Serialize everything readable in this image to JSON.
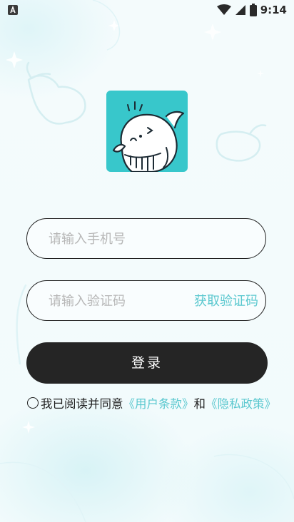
{
  "status_bar": {
    "time": "9:14"
  },
  "login": {
    "phone_placeholder": "请输入手机号",
    "code_placeholder": "请输入验证码",
    "get_code_label": "获取验证码",
    "login_label": "登录"
  },
  "agreement": {
    "prefix": "我已阅读并同意",
    "user_terms": "《用户条款》",
    "and": "和",
    "privacy_policy": "《隐私政策》"
  },
  "colors": {
    "accent": "#5bc8cf",
    "button": "#252525",
    "logo_bg": "#38c7cb"
  },
  "icons": {
    "status_left": "app-notification-icon",
    "wifi": "wifi-icon",
    "signal": "signal-icon",
    "battery": "battery-icon",
    "logo": "whale-logo-icon"
  }
}
